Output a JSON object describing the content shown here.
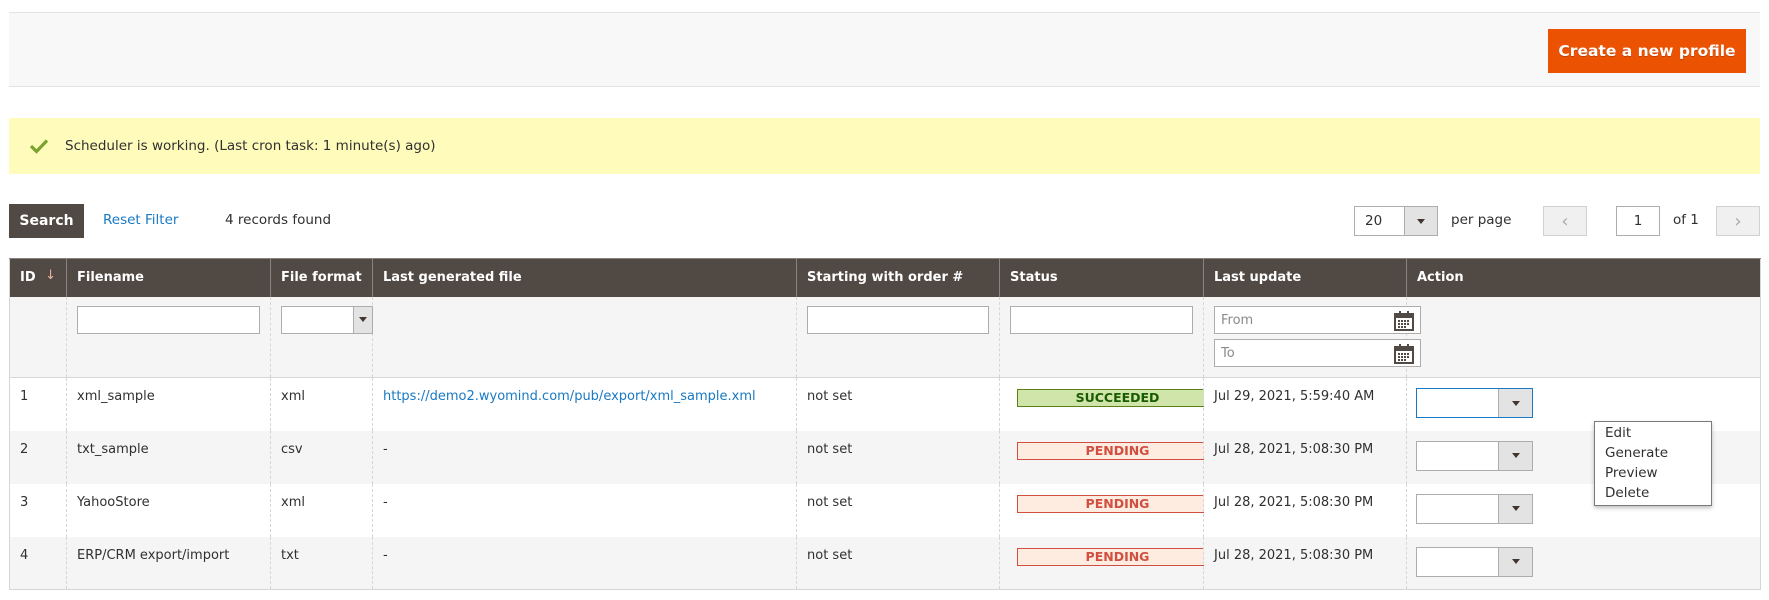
{
  "header": {
    "create_button": "Create a new profile"
  },
  "notice": {
    "icon": "checkmark-icon",
    "message": "Scheduler is working. (Last cron task: 1 minute(s) ago)"
  },
  "toolbar": {
    "search_label": "Search",
    "reset_label": "Reset Filter",
    "records_found": "4 records found",
    "per_page_value": "20",
    "per_page_label": "per page",
    "prev_icon": "‹",
    "next_icon": "›",
    "page_current": "1",
    "page_of": "of 1"
  },
  "table": {
    "columns": [
      "ID",
      "Filename",
      "File format",
      "Last generated file",
      "Starting with order #",
      "Status",
      "Last update",
      "Action"
    ],
    "sort_indicator": "↓",
    "filters": {
      "filename_value": "",
      "file_format_value": "",
      "order_value": "",
      "status_value": "",
      "date_from_placeholder": "From",
      "date_to_placeholder": "To"
    },
    "rows": [
      {
        "id": "1",
        "filename": "xml_sample",
        "format": "xml",
        "last_file": "https://demo2.wyomind.com/pub/export/xml_sample.xml",
        "order": "not set",
        "status": "SUCCEEDED",
        "status_type": "success",
        "updated": "Jul 29, 2021, 5:59:40 AM"
      },
      {
        "id": "2",
        "filename": "txt_sample",
        "format": "csv",
        "last_file": "-",
        "order": "not set",
        "status": "PENDING",
        "status_type": "pending",
        "updated": "Jul 28, 2021, 5:08:30 PM"
      },
      {
        "id": "3",
        "filename": "YahooStore",
        "format": "xml",
        "last_file": "-",
        "order": "not set",
        "status": "PENDING",
        "status_type": "pending",
        "updated": "Jul 28, 2021, 5:08:30 PM"
      },
      {
        "id": "4",
        "filename": "ERP/CRM export/import",
        "format": "txt",
        "last_file": "-",
        "order": "not set",
        "status": "PENDING",
        "status_type": "pending",
        "updated": "Jul 28, 2021, 5:08:30 PM"
      }
    ]
  },
  "action_dropdown": {
    "options": [
      "Edit",
      "Generate",
      "Preview",
      "Delete"
    ]
  },
  "colors": {
    "accent": "#eb5202",
    "header_bg": "#514943",
    "link": "#1979c3",
    "notice_bg": "#fffbbb",
    "success_bg": "#d0e5a9",
    "pending_bg": "#ffece0"
  }
}
